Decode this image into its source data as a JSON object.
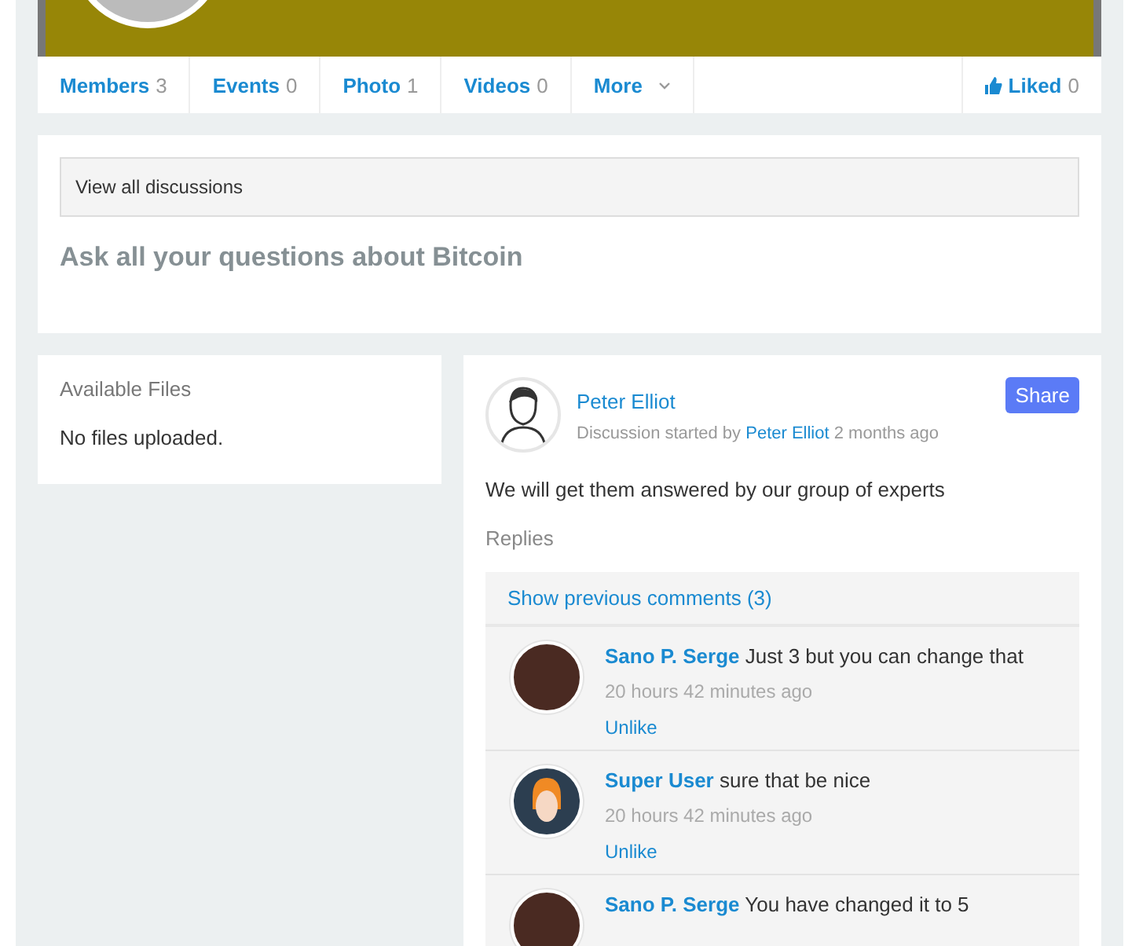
{
  "nav": {
    "tabs": [
      {
        "label": "Members",
        "count": "3"
      },
      {
        "label": "Events",
        "count": "0"
      },
      {
        "label": "Photo",
        "count": "1"
      },
      {
        "label": "Videos",
        "count": "0"
      }
    ],
    "more": "More",
    "liked": {
      "label": "Liked",
      "count": "0"
    }
  },
  "discussion_header": {
    "view_all": "View all discussions",
    "title": "Ask all your questions about Bitcoin"
  },
  "files": {
    "title": "Available Files",
    "empty": "No files uploaded."
  },
  "post": {
    "author": "Peter Elliot",
    "started_prefix": "Discussion started by",
    "started_by": "Peter Elliot",
    "started_when": "2 months ago",
    "share": "Share",
    "body": "We will get them answered by our group of experts",
    "replies_label": "Replies",
    "show_previous": "Show previous comments (3)",
    "comments": [
      {
        "kind": "photo",
        "author": "Sano P. Serge",
        "text": "Just 3 but you can change that",
        "time": "20 hours 42 minutes ago",
        "action": "Unlike"
      },
      {
        "kind": "cartoon",
        "author": "Super User",
        "text": "sure that be nice",
        "time": "20 hours 42 minutes ago",
        "action": "Unlike"
      },
      {
        "kind": "photo",
        "author": "Sano P. Serge",
        "text": "You have changed it to 5"
      }
    ]
  }
}
